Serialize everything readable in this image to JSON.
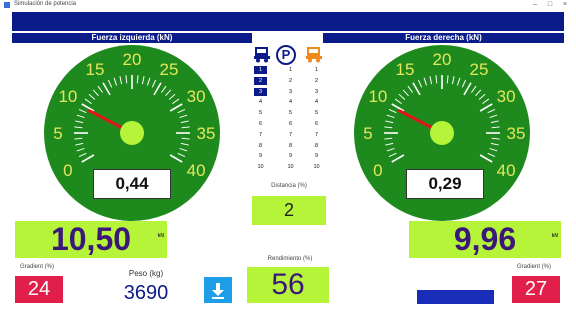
{
  "window": {
    "title": "Simulación de potencia",
    "controls": [
      "–",
      "□",
      "×"
    ]
  },
  "headers": {
    "left": "Fuerza izquierda (kN)",
    "right": "Fuerza derecha (kN)"
  },
  "gauge_ticks": [
    "0",
    "5",
    "10",
    "15",
    "20",
    "25",
    "30",
    "35",
    "40"
  ],
  "left": {
    "gauge_value": "0,44",
    "needle_kn": 9.6,
    "force": "10,50",
    "unit": "kN",
    "slope_label": "Gradient (%)",
    "slope_value": "24",
    "weight_label": "Peso (kg)",
    "weight_value": "3690"
  },
  "right": {
    "gauge_value": "0,29",
    "needle_kn": 9.6,
    "force": "9,96",
    "unit": "kN",
    "slope_label": "Gradient (%)",
    "slope_value": "27"
  },
  "center": {
    "parking_icon": "P",
    "gear_numbers": [
      "1",
      "2",
      "3",
      "4",
      "5",
      "6",
      "7",
      "8",
      "9",
      "10"
    ],
    "left_selected": 3,
    "distance_label": "Distancia (%)",
    "distance_value": "2",
    "efficiency_label": "Rendimiento (%)",
    "efficiency_value": "56",
    "download_icon": "download-icon"
  },
  "colors": {
    "navy": "#0c1b8a",
    "gauge_green": "#1e8a1e",
    "lime": "#b6f43a",
    "red": "#e0204a",
    "value_purple": "#3a1778",
    "tick_yellow": "#e6e65a",
    "orange": "#f08a1c",
    "blue_button": "#1e9ee8"
  }
}
